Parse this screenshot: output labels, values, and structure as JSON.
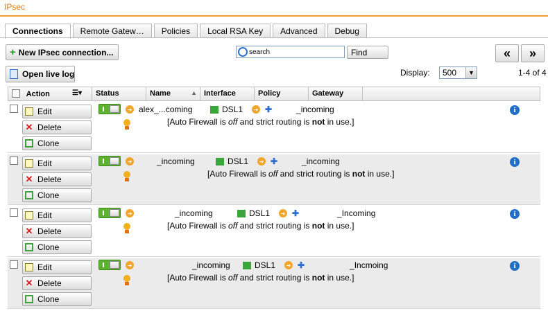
{
  "app": {
    "title": "IPsec"
  },
  "tabs": [
    {
      "label": "Connections",
      "active": true
    },
    {
      "label": "Remote Gatew…",
      "active": false
    },
    {
      "label": "Policies",
      "active": false
    },
    {
      "label": "Local RSA Key",
      "active": false
    },
    {
      "label": "Advanced",
      "active": false
    },
    {
      "label": "Debug",
      "active": false
    }
  ],
  "toolbar": {
    "new_label": "New IPsec connection...",
    "live_log_label": "Open live log",
    "search_placeholder": "search",
    "find_label": "Find",
    "prev_label": "«",
    "next_label": "»"
  },
  "display": {
    "label": "Display:",
    "value": "500",
    "count": "1-4 of 4"
  },
  "table": {
    "headers": {
      "action": "Action",
      "status": "Status",
      "name": "Name",
      "interface": "Interface",
      "policy": "Policy",
      "gateway": "Gateway"
    },
    "rows": [
      {
        "name": "alex_...coming",
        "interface": "DSL1",
        "gateway": "_incoming",
        "line2_prefix": "",
        "line2_note": "[Auto Firewall is off and strict routing is not in use.]",
        "edit": "Edit",
        "delete": "Delete",
        "clone": "Clone"
      },
      {
        "name": "_incoming",
        "interface": "DSL1",
        "gateway": "_incoming",
        "line2_prefix": "",
        "line2_note": "[Auto Firewall is off and strict routing is not in use.]",
        "edit": "Edit",
        "delete": "Delete",
        "clone": "Clone"
      },
      {
        "name": "_incoming",
        "interface": "DSL1",
        "gateway": "_Incoming",
        "line2_prefix": "",
        "line2_note": "[Auto Firewall is off and strict routing is not in use.]",
        "edit": "Edit",
        "delete": "Delete",
        "clone": "Clone"
      },
      {
        "name": "_incoming",
        "interface": "DSL1",
        "gateway": "_Incmoing",
        "line2_prefix": "",
        "line2_note": "[Auto Firewall is off and strict routing is not in use.]",
        "edit": "Edit",
        "delete": "Delete",
        "clone": "Clone"
      }
    ]
  },
  "colors": {
    "accent": "#e07a12",
    "toggle_on": "#5fb22f",
    "info": "#1f6fc9"
  }
}
